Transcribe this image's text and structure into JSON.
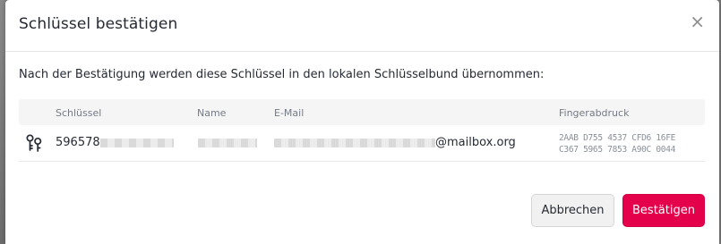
{
  "dialog": {
    "title": "Schlüssel bestätigen",
    "close_label": "×",
    "intro": "Nach der Bestätigung werden diese Schlüssel in den lokalen Schlüsselbund übernommen:"
  },
  "table": {
    "headers": [
      "Schlüssel",
      "Name",
      "E-Mail",
      "Fingerabdruck"
    ],
    "rows": [
      {
        "key_prefix": "596578",
        "email_suffix": "@mailbox.org",
        "fingerprint_line1": "2AAB D755 4537 CFD6 16FE",
        "fingerprint_line2": "C367 5965 7853 A90C 0044"
      }
    ]
  },
  "buttons": {
    "cancel": "Abbrechen",
    "confirm": "Bestätigen"
  },
  "colors": {
    "accent": "#e5004b"
  }
}
